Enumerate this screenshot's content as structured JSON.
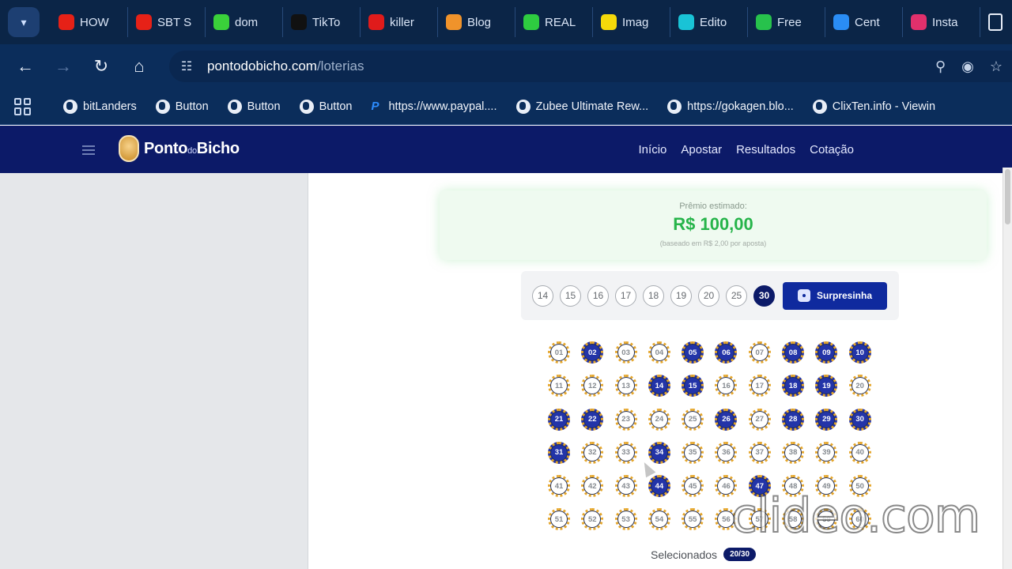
{
  "tabs": [
    {
      "label": "HOW",
      "icon": "youtube-icon",
      "color": "#e62117"
    },
    {
      "label": "SBT S",
      "icon": "youtube-icon",
      "color": "#e62117"
    },
    {
      "label": "dom",
      "icon": "play-icon",
      "color": "#3ad13a"
    },
    {
      "label": "TikTo",
      "icon": "tiktok-icon",
      "color": "#111111"
    },
    {
      "label": "killer",
      "icon": "killer-icon",
      "color": "#e01b1b"
    },
    {
      "label": "Blog",
      "icon": "blogger-icon",
      "color": "#f0932b"
    },
    {
      "label": "REAL",
      "icon": "v-icon",
      "color": "#2ecc40"
    },
    {
      "label": "Imag",
      "icon": "check-icon",
      "color": "#f5d90a"
    },
    {
      "label": "Edito",
      "icon": "play-icon",
      "color": "#19c3d6"
    },
    {
      "label": "Free",
      "icon": "px-icon",
      "color": "#27c24c"
    },
    {
      "label": "Cent",
      "icon": "play-icon",
      "color": "#2a8df5"
    },
    {
      "label": "Insta",
      "icon": "instagram-icon",
      "color": "#e1306c"
    }
  ],
  "address": {
    "domain": "pontodobicho.com",
    "path": "/loterias"
  },
  "bookmarks": [
    {
      "label": "bitLanders",
      "icon": "globe-icon"
    },
    {
      "label": "Button",
      "icon": "globe-icon"
    },
    {
      "label": "Button",
      "icon": "globe-icon"
    },
    {
      "label": "Button",
      "icon": "globe-icon"
    },
    {
      "label": "https://www.paypal....",
      "icon": "paypal-icon"
    },
    {
      "label": "Zubee Ultimate Rew...",
      "icon": "globe-icon"
    },
    {
      "label": "https://gokagen.blo...",
      "icon": "globe-icon"
    },
    {
      "label": "ClixTen.info - Viewin",
      "icon": "globe-icon"
    }
  ],
  "site": {
    "logo": {
      "part1": "Ponto",
      "part2": "do",
      "part3": "Bicho"
    },
    "nav": [
      "Início",
      "Apostar",
      "Resultados",
      "Cotação"
    ]
  },
  "prize": {
    "label": "Prêmio estimado:",
    "value": "R$ 100,00",
    "note": "(baseado em R$ 2,00 por aposta)"
  },
  "quantity_options": [
    "14",
    "15",
    "16",
    "17",
    "18",
    "19",
    "20",
    "25",
    "30"
  ],
  "quantity_selected": "30",
  "surprise_label": "Surpresinha",
  "numbers": [
    "01",
    "02",
    "03",
    "04",
    "05",
    "06",
    "07",
    "08",
    "09",
    "10",
    "11",
    "12",
    "13",
    "14",
    "15",
    "16",
    "17",
    "18",
    "19",
    "20",
    "21",
    "22",
    "23",
    "24",
    "25",
    "26",
    "27",
    "28",
    "29",
    "30",
    "31",
    "32",
    "33",
    "34",
    "35",
    "36",
    "37",
    "38",
    "39",
    "40",
    "41",
    "42",
    "43",
    "44",
    "45",
    "46",
    "47",
    "48",
    "49",
    "50",
    "51",
    "52",
    "53",
    "54",
    "55",
    "56",
    "57",
    "58",
    "59",
    "60"
  ],
  "selected_numbers": [
    "02",
    "05",
    "06",
    "08",
    "09",
    "10",
    "14",
    "15",
    "18",
    "19",
    "21",
    "22",
    "26",
    "28",
    "29",
    "30",
    "31",
    "34",
    "44",
    "47"
  ],
  "selected_label": "Selecionados",
  "selected_count": "20/30",
  "watermark": "clideo.com"
}
